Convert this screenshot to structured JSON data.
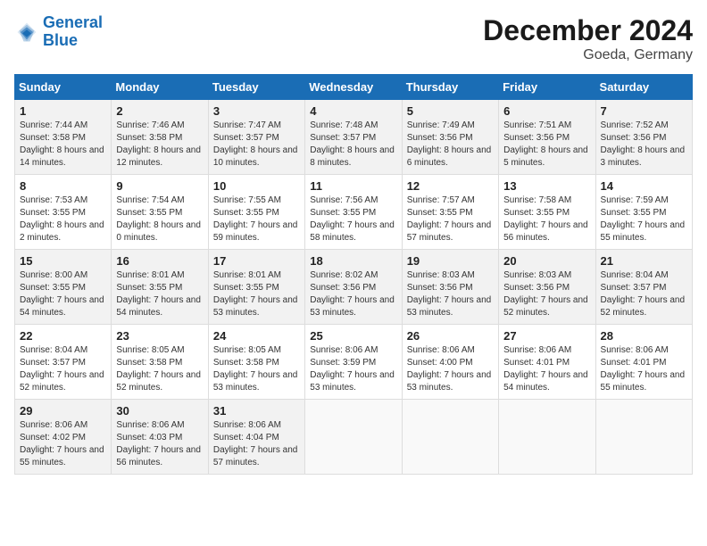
{
  "logo": {
    "line1": "General",
    "line2": "Blue"
  },
  "title": "December 2024",
  "subtitle": "Goeda, Germany",
  "weekdays": [
    "Sunday",
    "Monday",
    "Tuesday",
    "Wednesday",
    "Thursday",
    "Friday",
    "Saturday"
  ],
  "weeks": [
    [
      {
        "day": "1",
        "sunrise": "7:44 AM",
        "sunset": "3:58 PM",
        "daylight": "8 hours and 14 minutes."
      },
      {
        "day": "2",
        "sunrise": "7:46 AM",
        "sunset": "3:58 PM",
        "daylight": "8 hours and 12 minutes."
      },
      {
        "day": "3",
        "sunrise": "7:47 AM",
        "sunset": "3:57 PM",
        "daylight": "8 hours and 10 minutes."
      },
      {
        "day": "4",
        "sunrise": "7:48 AM",
        "sunset": "3:57 PM",
        "daylight": "8 hours and 8 minutes."
      },
      {
        "day": "5",
        "sunrise": "7:49 AM",
        "sunset": "3:56 PM",
        "daylight": "8 hours and 6 minutes."
      },
      {
        "day": "6",
        "sunrise": "7:51 AM",
        "sunset": "3:56 PM",
        "daylight": "8 hours and 5 minutes."
      },
      {
        "day": "7",
        "sunrise": "7:52 AM",
        "sunset": "3:56 PM",
        "daylight": "8 hours and 3 minutes."
      }
    ],
    [
      {
        "day": "8",
        "sunrise": "7:53 AM",
        "sunset": "3:55 PM",
        "daylight": "8 hours and 2 minutes."
      },
      {
        "day": "9",
        "sunrise": "7:54 AM",
        "sunset": "3:55 PM",
        "daylight": "8 hours and 0 minutes."
      },
      {
        "day": "10",
        "sunrise": "7:55 AM",
        "sunset": "3:55 PM",
        "daylight": "7 hours and 59 minutes."
      },
      {
        "day": "11",
        "sunrise": "7:56 AM",
        "sunset": "3:55 PM",
        "daylight": "7 hours and 58 minutes."
      },
      {
        "day": "12",
        "sunrise": "7:57 AM",
        "sunset": "3:55 PM",
        "daylight": "7 hours and 57 minutes."
      },
      {
        "day": "13",
        "sunrise": "7:58 AM",
        "sunset": "3:55 PM",
        "daylight": "7 hours and 56 minutes."
      },
      {
        "day": "14",
        "sunrise": "7:59 AM",
        "sunset": "3:55 PM",
        "daylight": "7 hours and 55 minutes."
      }
    ],
    [
      {
        "day": "15",
        "sunrise": "8:00 AM",
        "sunset": "3:55 PM",
        "daylight": "7 hours and 54 minutes."
      },
      {
        "day": "16",
        "sunrise": "8:01 AM",
        "sunset": "3:55 PM",
        "daylight": "7 hours and 54 minutes."
      },
      {
        "day": "17",
        "sunrise": "8:01 AM",
        "sunset": "3:55 PM",
        "daylight": "7 hours and 53 minutes."
      },
      {
        "day": "18",
        "sunrise": "8:02 AM",
        "sunset": "3:56 PM",
        "daylight": "7 hours and 53 minutes."
      },
      {
        "day": "19",
        "sunrise": "8:03 AM",
        "sunset": "3:56 PM",
        "daylight": "7 hours and 53 minutes."
      },
      {
        "day": "20",
        "sunrise": "8:03 AM",
        "sunset": "3:56 PM",
        "daylight": "7 hours and 52 minutes."
      },
      {
        "day": "21",
        "sunrise": "8:04 AM",
        "sunset": "3:57 PM",
        "daylight": "7 hours and 52 minutes."
      }
    ],
    [
      {
        "day": "22",
        "sunrise": "8:04 AM",
        "sunset": "3:57 PM",
        "daylight": "7 hours and 52 minutes."
      },
      {
        "day": "23",
        "sunrise": "8:05 AM",
        "sunset": "3:58 PM",
        "daylight": "7 hours and 52 minutes."
      },
      {
        "day": "24",
        "sunrise": "8:05 AM",
        "sunset": "3:58 PM",
        "daylight": "7 hours and 53 minutes."
      },
      {
        "day": "25",
        "sunrise": "8:06 AM",
        "sunset": "3:59 PM",
        "daylight": "7 hours and 53 minutes."
      },
      {
        "day": "26",
        "sunrise": "8:06 AM",
        "sunset": "4:00 PM",
        "daylight": "7 hours and 53 minutes."
      },
      {
        "day": "27",
        "sunrise": "8:06 AM",
        "sunset": "4:01 PM",
        "daylight": "7 hours and 54 minutes."
      },
      {
        "day": "28",
        "sunrise": "8:06 AM",
        "sunset": "4:01 PM",
        "daylight": "7 hours and 55 minutes."
      }
    ],
    [
      {
        "day": "29",
        "sunrise": "8:06 AM",
        "sunset": "4:02 PM",
        "daylight": "7 hours and 55 minutes."
      },
      {
        "day": "30",
        "sunrise": "8:06 AM",
        "sunset": "4:03 PM",
        "daylight": "7 hours and 56 minutes."
      },
      {
        "day": "31",
        "sunrise": "8:06 AM",
        "sunset": "4:04 PM",
        "daylight": "7 hours and 57 minutes."
      },
      null,
      null,
      null,
      null
    ]
  ]
}
